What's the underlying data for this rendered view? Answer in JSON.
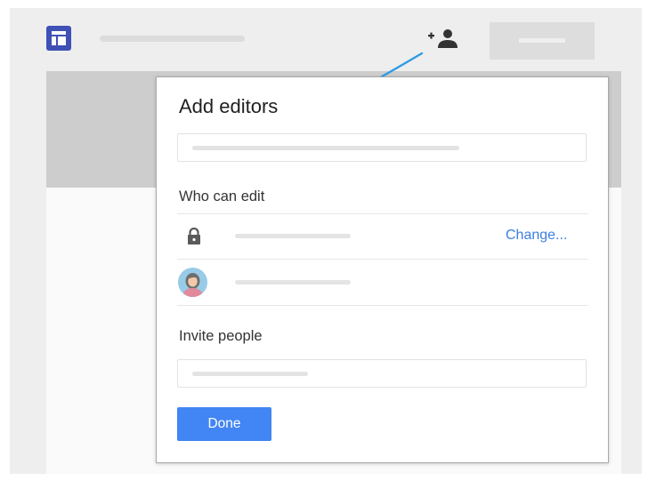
{
  "colors": {
    "frame_bg": "#eeeeee",
    "app_logo": "#3f51b5",
    "arrow": "#2f9be3",
    "link": "#3b7fe0",
    "primary_button": "#4285f4"
  },
  "toolbar": {
    "app_icon": "forms-app-icon",
    "add_editors_icon": "person-add-icon"
  },
  "dialog": {
    "title": "Add editors",
    "who_can_edit": {
      "label": "Who can edit",
      "lock_icon": "lock-icon",
      "change_link": "Change..."
    },
    "invite": {
      "label": "Invite people"
    },
    "done_button": "Done"
  }
}
